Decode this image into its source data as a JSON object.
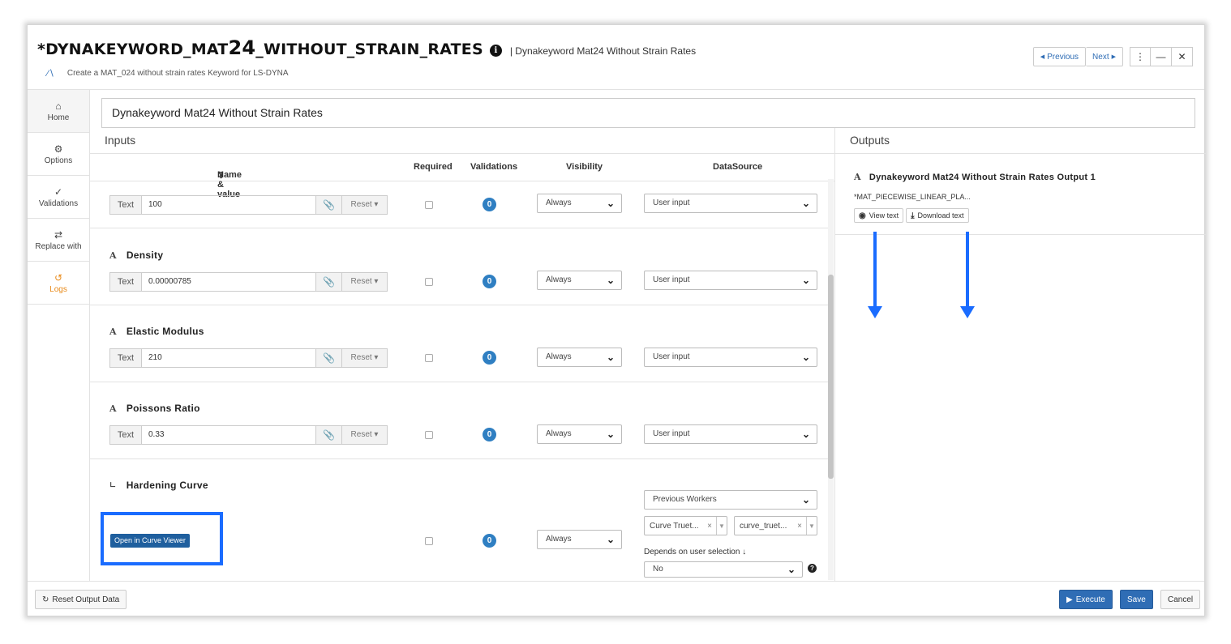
{
  "header": {
    "title_prefix": "*DYNAKEYWORD_MAT",
    "title_big": "24",
    "title_suffix": "_WITHOUT_STRAIN_RATES",
    "subtitle": "| Dynakeyword Mat24 Without Strain Rates",
    "description": "Create a MAT_024 without strain rates Keyword for LS-DYNA",
    "previous_label": "Previous",
    "next_label": "Next"
  },
  "sidebar": {
    "items": [
      {
        "label": "Home",
        "icon": "home-icon"
      },
      {
        "label": "Options",
        "icon": "gear-icon"
      },
      {
        "label": "Validations",
        "icon": "check-icon"
      },
      {
        "label": "Replace with",
        "icon": "swap-icon"
      },
      {
        "label": "Logs",
        "icon": "history-icon"
      }
    ]
  },
  "name_field": {
    "value": "Dynakeyword Mat24 Without Strain Rates"
  },
  "inputs": {
    "title": "Inputs",
    "columns": [
      "Name & value",
      "Required",
      "Validations",
      "Visibility",
      "DataSource"
    ],
    "rows": [
      {
        "label": "",
        "type": "Text",
        "value": "100",
        "reset": "Reset",
        "validations": "0",
        "visibility": "Always",
        "datasource": "User input"
      },
      {
        "label": "Density",
        "type": "Text",
        "value": "0.00000785",
        "reset": "Reset",
        "validations": "0",
        "visibility": "Always",
        "datasource": "User input"
      },
      {
        "label": "Elastic Modulus",
        "type": "Text",
        "value": "210",
        "reset": "Reset",
        "validations": "0",
        "visibility": "Always",
        "datasource": "User input"
      },
      {
        "label": "Poissons Ratio",
        "type": "Text",
        "value": "0.33",
        "reset": "Reset",
        "validations": "0",
        "visibility": "Always",
        "datasource": "User input"
      }
    ],
    "curve": {
      "label": "Hardening Curve",
      "button": "Open in Curve Viewer",
      "validations": "0",
      "visibility": "Always",
      "datasource": "Previous Workers",
      "tag1": "Curve Truet...",
      "tag2": "curve_truet...",
      "depends_label": "Depends on user selection",
      "depends_value": "No"
    }
  },
  "outputs": {
    "title": "Outputs",
    "item_title": "Dynakeyword Mat24 Without Strain Rates Output 1",
    "item_text": "*MAT_PIECEWISE_LINEAR_PLA...",
    "view_label": "View text",
    "download_label": "Download text"
  },
  "footer": {
    "reset_label": "Reset Output Data",
    "execute_label": "Execute",
    "save_label": "Save",
    "cancel_label": "Cancel"
  },
  "colors": {
    "accent": "#2f6db5",
    "annotation": "#1a6cff",
    "logs": "#e88a1a"
  }
}
